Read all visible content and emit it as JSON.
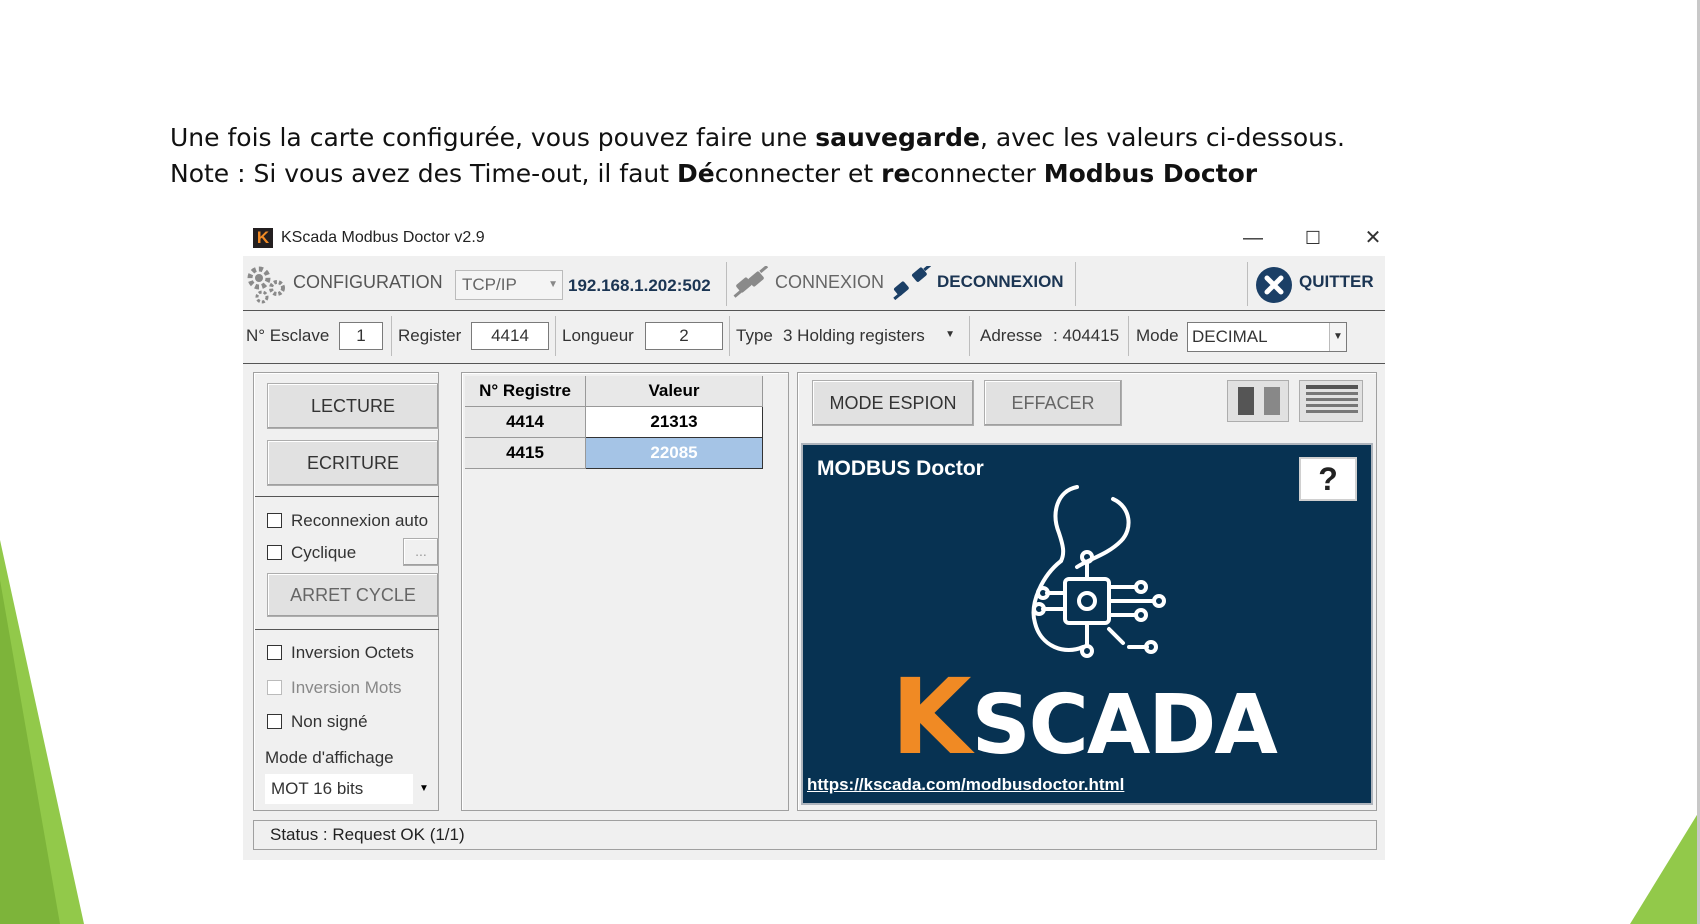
{
  "slide": {
    "line1_a": "Une fois la carte configurée, vous pouvez faire une ",
    "line1_b": "sauvegarde",
    "line1_c": ", avec les valeurs ci-dessous.",
    "line2_a": "Note : Si vous avez des Time-out, il faut ",
    "line2_b": "Dé",
    "line2_c": "connecter et ",
    "line2_d": "re",
    "line2_e": "connecter ",
    "line2_f": "Modbus Doctor"
  },
  "window": {
    "title": "KScada Modbus Doctor v2.9",
    "app_icon_letter": "K",
    "minimize": "—",
    "maximize": "☐",
    "close": "✕"
  },
  "toolbar": {
    "configuration": "CONFIGURATION",
    "protocol": "TCP/IP",
    "address": "192.168.1.202:502",
    "connexion": "CONNEXION",
    "deconnexion": "DECONNEXION",
    "quitter": "QUITTER"
  },
  "params": {
    "esclave_label": "N° Esclave",
    "esclave_value": "1",
    "register_label": "Register",
    "register_value": "4414",
    "longueur_label": "Longueur",
    "longueur_value": "2",
    "type_label": "Type",
    "type_value": "3 Holding registers",
    "adresse_label": "Adresse",
    "adresse_value": ": 404415",
    "mode_label": "Mode",
    "mode_value": "DECIMAL"
  },
  "left": {
    "lecture": "LECTURE",
    "ecriture": "ECRITURE",
    "reconnexion_auto": "Reconnexion auto",
    "cyclique": "Cyclique",
    "cyclique_btn": "...",
    "arret_cycle": "ARRET CYCLE",
    "inversion_octets": "Inversion Octets",
    "inversion_mots": "Inversion Mots",
    "non_signe": "Non signé",
    "mode_affichage_label": "Mode d'affichage",
    "mode_affichage_value": "MOT 16 bits"
  },
  "table": {
    "headers": [
      "N° Registre",
      "Valeur"
    ],
    "rows": [
      {
        "registre": "4414",
        "valeur": "21313"
      },
      {
        "registre": "4415",
        "valeur": "22085"
      }
    ]
  },
  "right": {
    "mode_espion": "MODE ESPION",
    "effacer": "EFFACER",
    "panel_title": "MODBUS Doctor",
    "help": "?",
    "logo_k": "K",
    "logo_rest": "SCADA",
    "link": "https://kscada.com/modbusdoctor.html"
  },
  "status": {
    "text": "Status : Request OK (1/1)"
  },
  "colors": {
    "panel_bg": "#073252",
    "logo_orange": "#f08a24",
    "slide_green": "#8cc63f"
  }
}
